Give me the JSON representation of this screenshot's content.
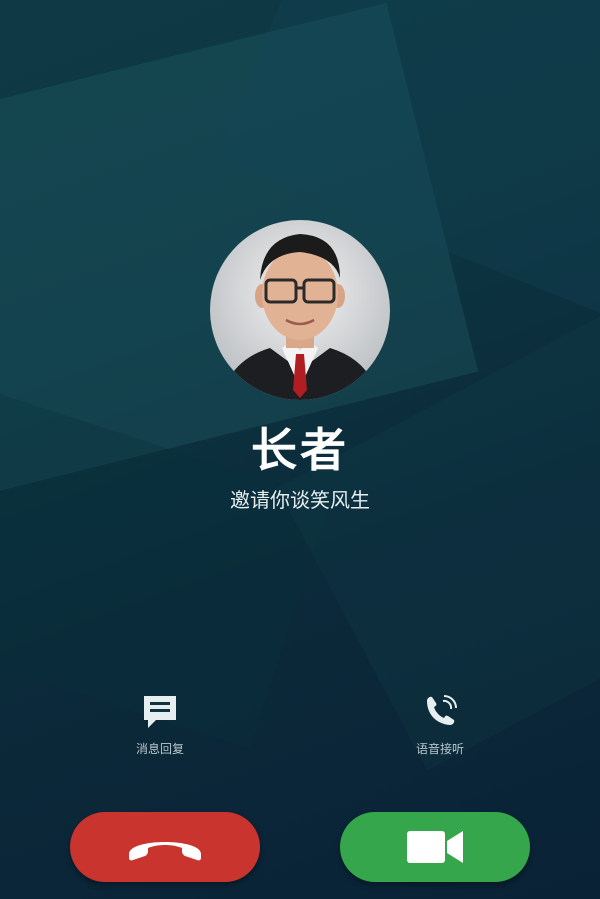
{
  "caller": {
    "name": "长者",
    "subtitle": "邀请你谈笑风生"
  },
  "actions": {
    "message_reply": {
      "label": "消息回复",
      "icon": "message-icon"
    },
    "voice_answer": {
      "label": "语音接听",
      "icon": "phone-ringing-icon"
    }
  },
  "buttons": {
    "decline": {
      "icon": "hang-up-icon",
      "color": "#c9342f"
    },
    "accept_video": {
      "icon": "video-camera-icon",
      "color": "#35a64b"
    }
  },
  "theme": {
    "background": "#0d3440",
    "accent_decline": "#c9342f",
    "accent_accept": "#35a64b"
  }
}
